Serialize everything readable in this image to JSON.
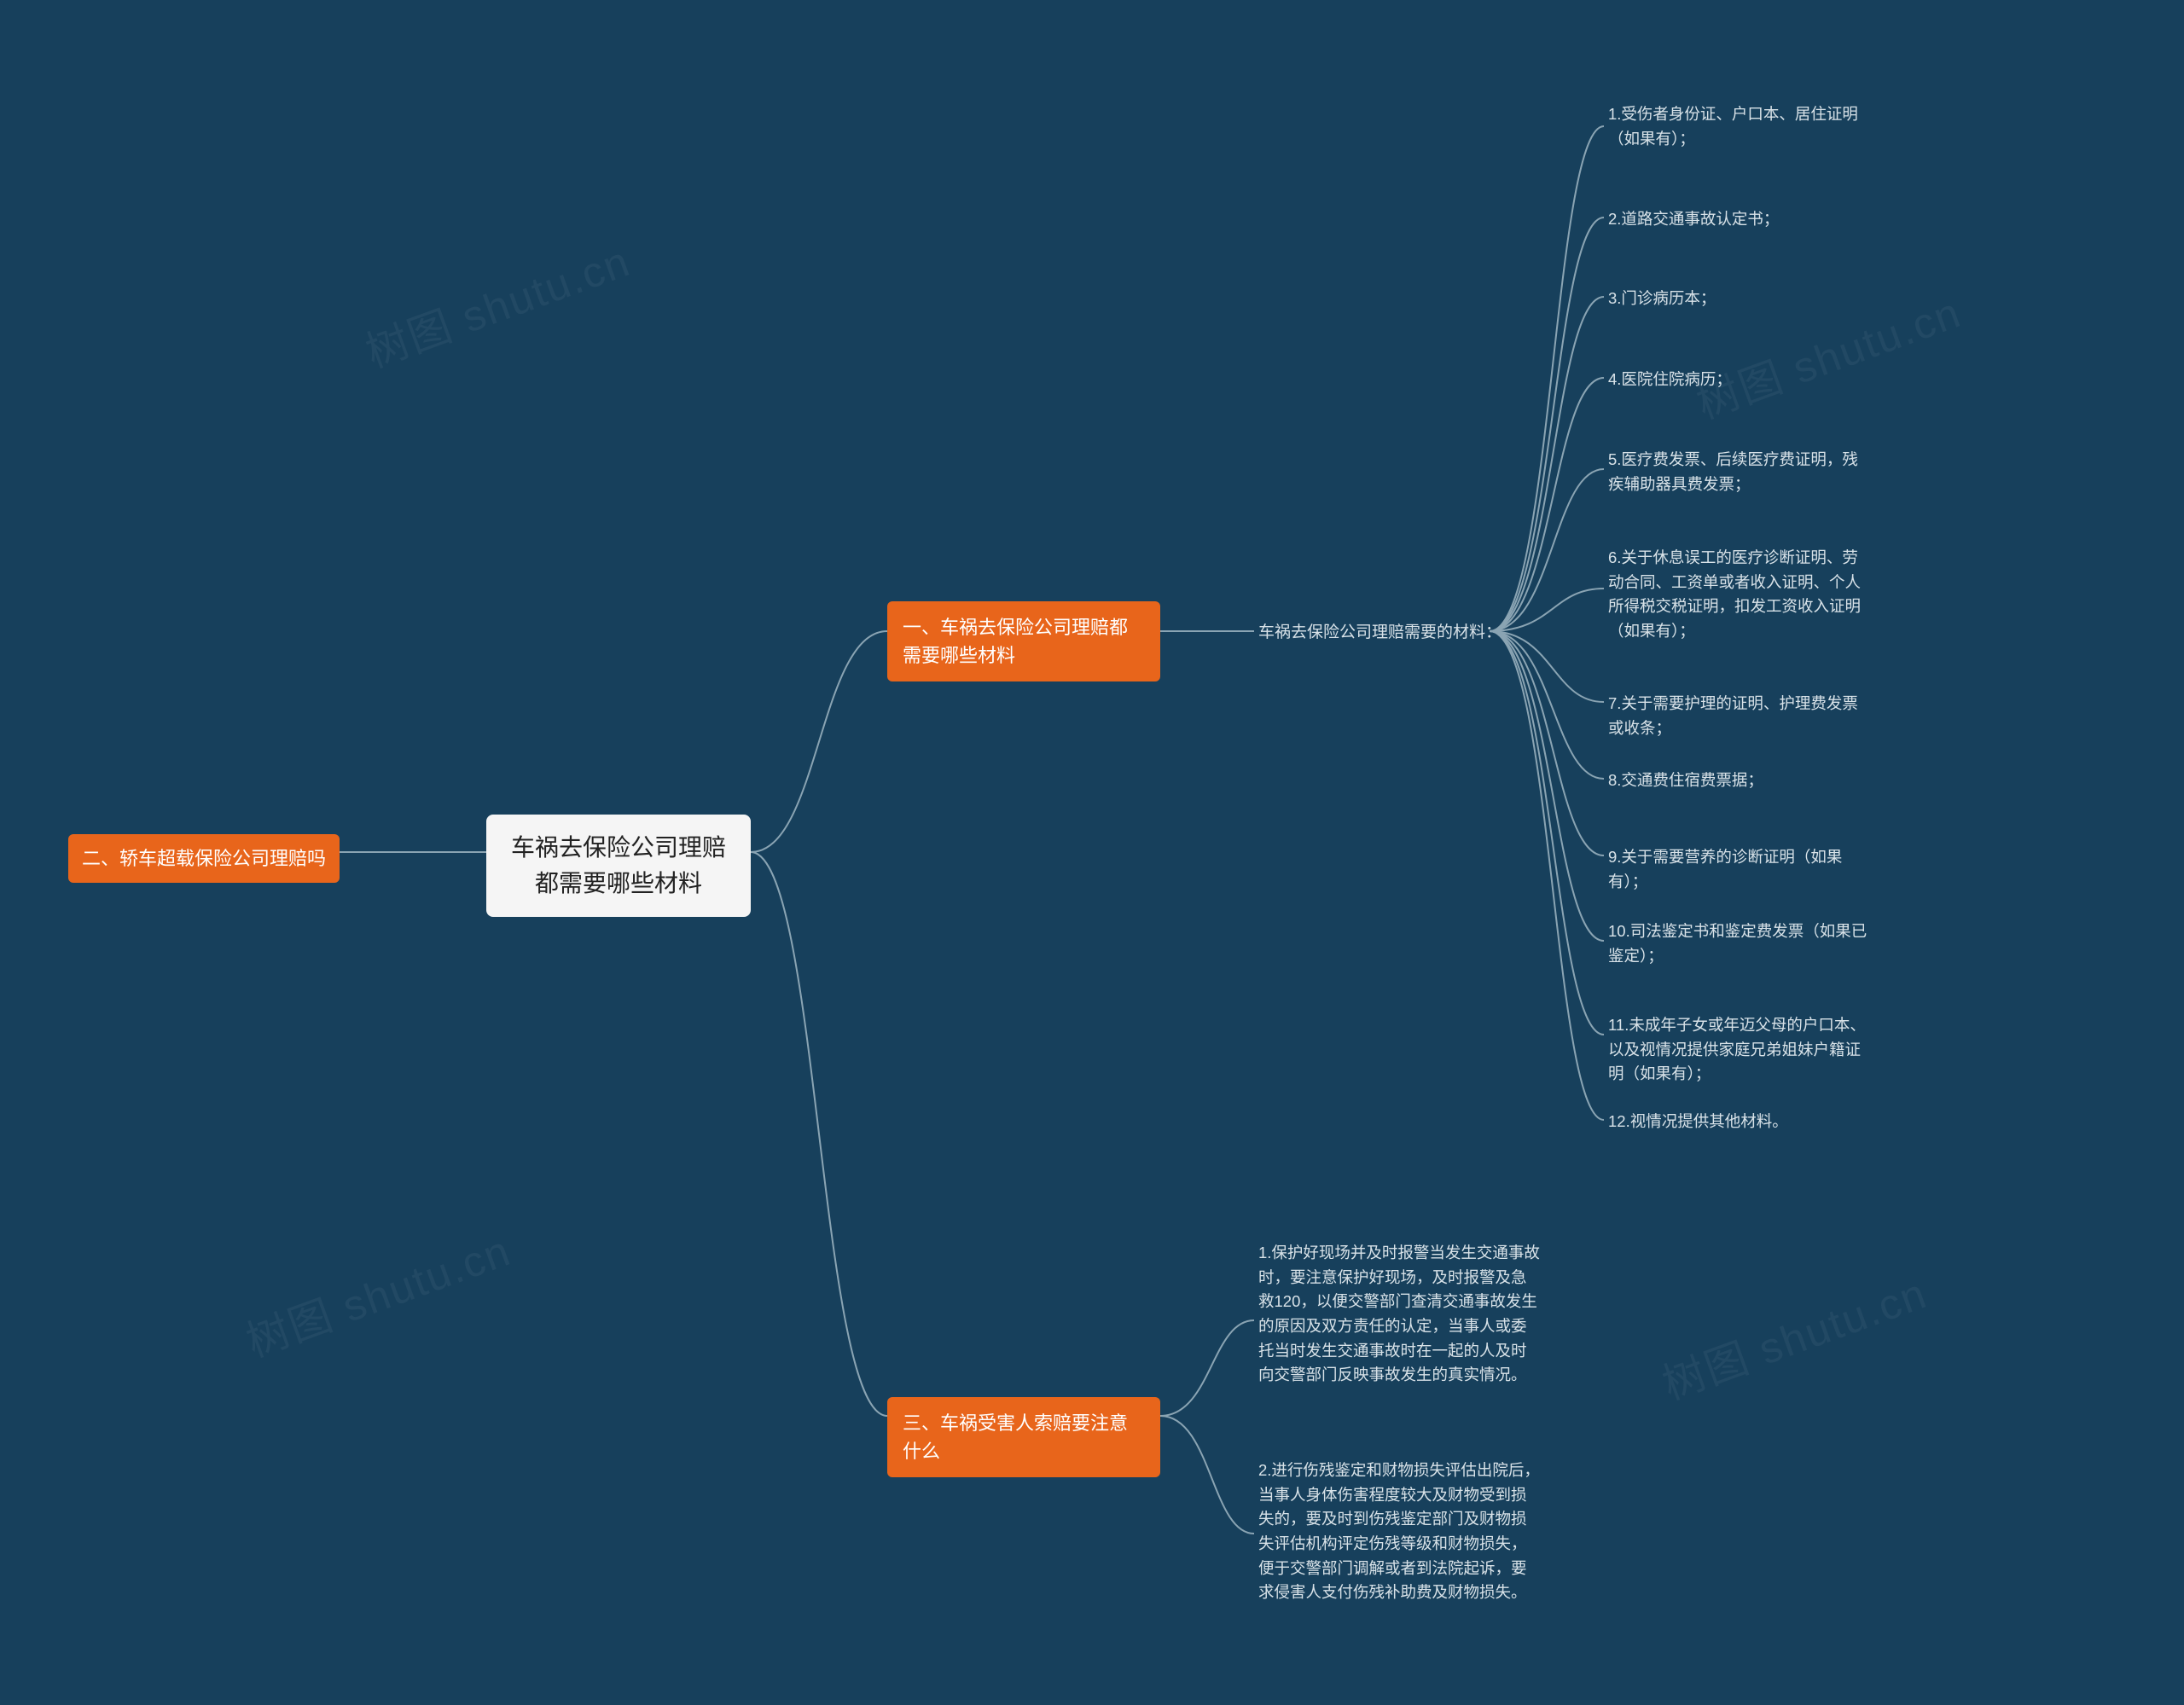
{
  "root": {
    "title": "车祸去保险公司理赔都需要哪些材料"
  },
  "branch_left": {
    "title": "二、轿车超载保险公司理赔吗"
  },
  "branch_a": {
    "title": "一、车祸去保险公司理赔都需要哪些材料"
  },
  "branch_c": {
    "title": "三、车祸受害人索赔要注意什么"
  },
  "mid_a": {
    "text": "车祸去保险公司理赔需要的材料："
  },
  "leaves_a": [
    "1.受伤者身份证、户口本、居住证明（如果有）；",
    "2.道路交通事故认定书；",
    "3.门诊病历本；",
    "4.医院住院病历；",
    "5.医疗费发票、后续医疗费证明，残疾辅助器具费发票；",
    "6.关于休息误工的医疗诊断证明、劳动合同、工资单或者收入证明、个人所得税交税证明，扣发工资收入证明（如果有）；",
    "7.关于需要护理的证明、护理费发票或收条；",
    "8.交通费住宿费票据；",
    "9.关于需要营养的诊断证明（如果有）；",
    "10.司法鉴定书和鉴定费发票（如果已鉴定）；",
    "11.未成年子女或年迈父母的户口本、以及视情况提供家庭兄弟姐妹户籍证明（如果有）；",
    "12.视情况提供其他材料。"
  ],
  "leaves_c": [
    "1.保护好现场并及时报警当发生交通事故时，要注意保护好现场，及时报警及急救120，以便交警部门查清交通事故发生的原因及双方责任的认定，当事人或委托当时发生交通事故时在一起的人及时向交警部门反映事故发生的真实情况。",
    "2.进行伤残鉴定和财物损失评估出院后，当事人身体伤害程度较大及财物受到损失的，要及时到伤残鉴定部门及财物损失评估机构评定伤残等级和财物损失，便于交警部门调解或者到法院起诉，要求侵害人支付伤残补助费及财物损失。"
  ],
  "watermark": "树图 shutu.cn"
}
